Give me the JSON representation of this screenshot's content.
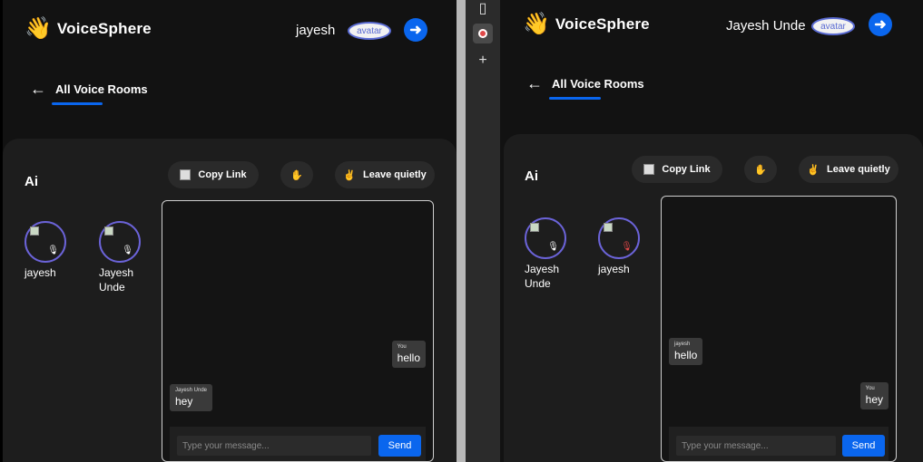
{
  "left_window": {
    "app_name": "VoiceSphere",
    "logo_icon": "waving-hand-icon",
    "user_name": "jayesh",
    "avatar_alt": "avatar",
    "back_label": "All Voice Rooms",
    "room_title": "Ai",
    "actions": {
      "copy_link": "Copy Link",
      "raise_hand": "✋",
      "leave": "Leave quietly"
    },
    "participants": [
      {
        "name": "jayesh",
        "mic": "mic-icon"
      },
      {
        "name": "Jayesh Unde",
        "mic": "mic-icon"
      }
    ],
    "messages": [
      {
        "who": "You",
        "text": "hello"
      },
      {
        "who": "Jayesh Unde",
        "text": "hey"
      }
    ],
    "input_placeholder": "Type your message...",
    "send_label": "Send"
  },
  "right_window": {
    "app_name": "VoiceSphere",
    "logo_icon": "waving-hand-icon",
    "user_name": "Jayesh Unde",
    "avatar_alt": "avatar",
    "back_label": "All Voice Rooms",
    "room_title": "Ai",
    "actions": {
      "copy_link": "Copy Link",
      "raise_hand": "✋",
      "leave": "Leave quietly"
    },
    "participants": [
      {
        "name": "Jayesh Unde",
        "mic": "mic-icon"
      },
      {
        "name": "jayesh",
        "mic": "mic-muted-icon"
      }
    ],
    "messages": [
      {
        "who": "jayesh",
        "text": "hello"
      },
      {
        "who": "You",
        "text": "hey"
      }
    ],
    "input_placeholder": "Type your message...",
    "send_label": "Send"
  },
  "colors": {
    "accent": "#0a66ee",
    "ring": "#6b63d8",
    "muted": "#e04848",
    "background": "#121212",
    "panel": "#1d1d1d"
  }
}
